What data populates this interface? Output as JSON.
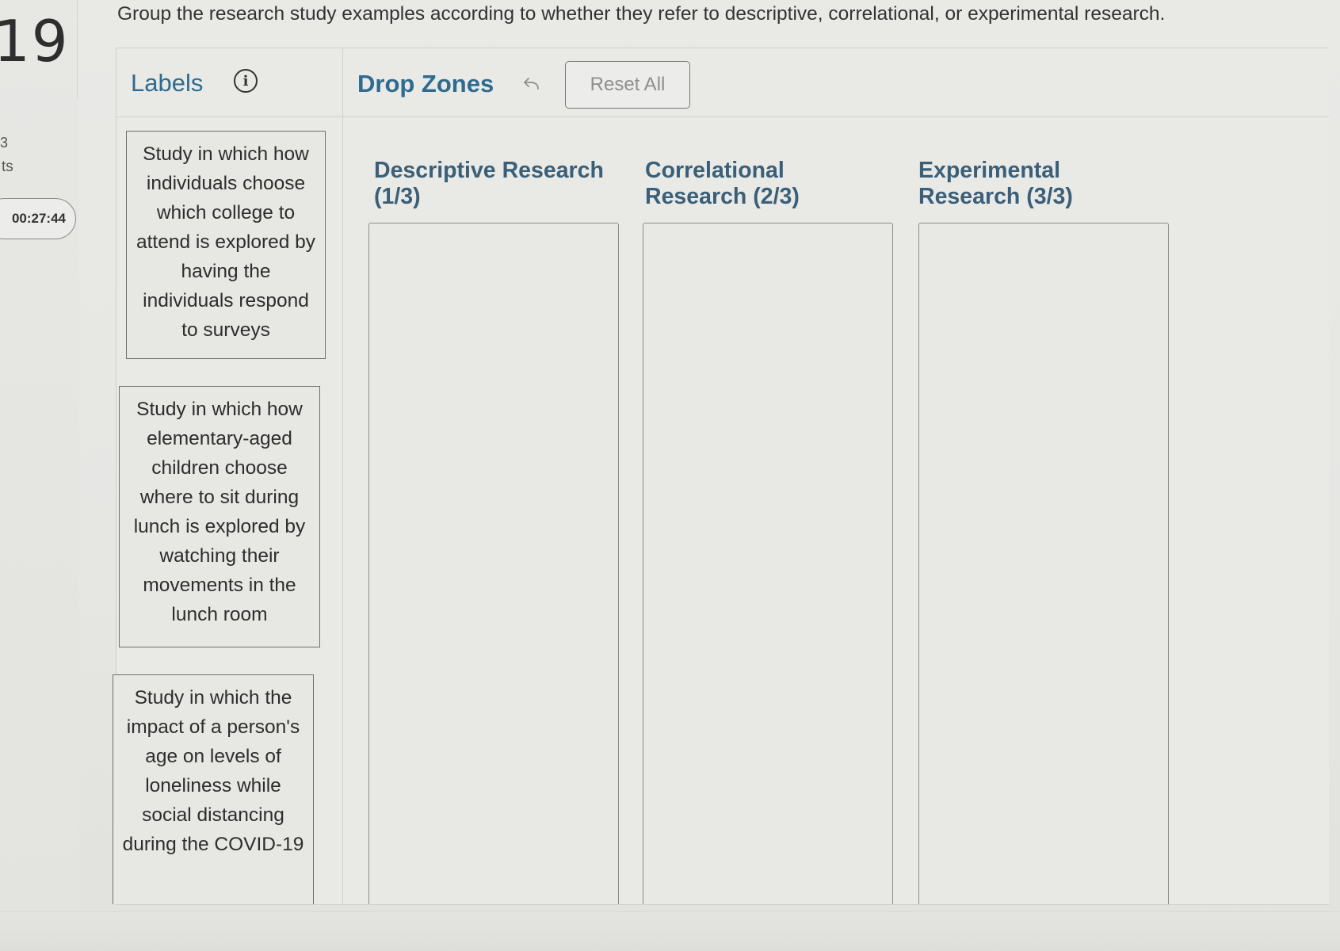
{
  "question": {
    "number": "19",
    "points_fragment": "3",
    "points_label": "ts",
    "timer": "00:27:44",
    "instructions": "Group the research study examples according to whether they refer to descriptive, correlational, or experimental research."
  },
  "toolbar": {
    "labels_heading": "Labels",
    "info_icon": "i",
    "drop_zones_heading": "Drop Zones",
    "reset_label": "Reset All"
  },
  "labels": [
    {
      "text": "Study in which how individuals choose which college to attend is explored by having the individuals respond to surveys"
    },
    {
      "text": "Study in which how elementary-aged children choose where to sit during lunch is explored by watching their movements in the lunch room"
    },
    {
      "text": "Study in which the impact of a person's age on levels of loneliness while social distancing during the COVID-19"
    }
  ],
  "zones": [
    {
      "title": "Descriptive Research (1/3)"
    },
    {
      "title": "Correlational Research (2/3)"
    },
    {
      "title": "Experimental Research (3/3)"
    }
  ],
  "icons": {
    "info": "info-circle-icon",
    "undo": "undo-arrow-icon"
  },
  "colors": {
    "heading_blue": "#2f6b8f",
    "zone_title": "#3a5f78",
    "background": "#e9e9e6"
  }
}
